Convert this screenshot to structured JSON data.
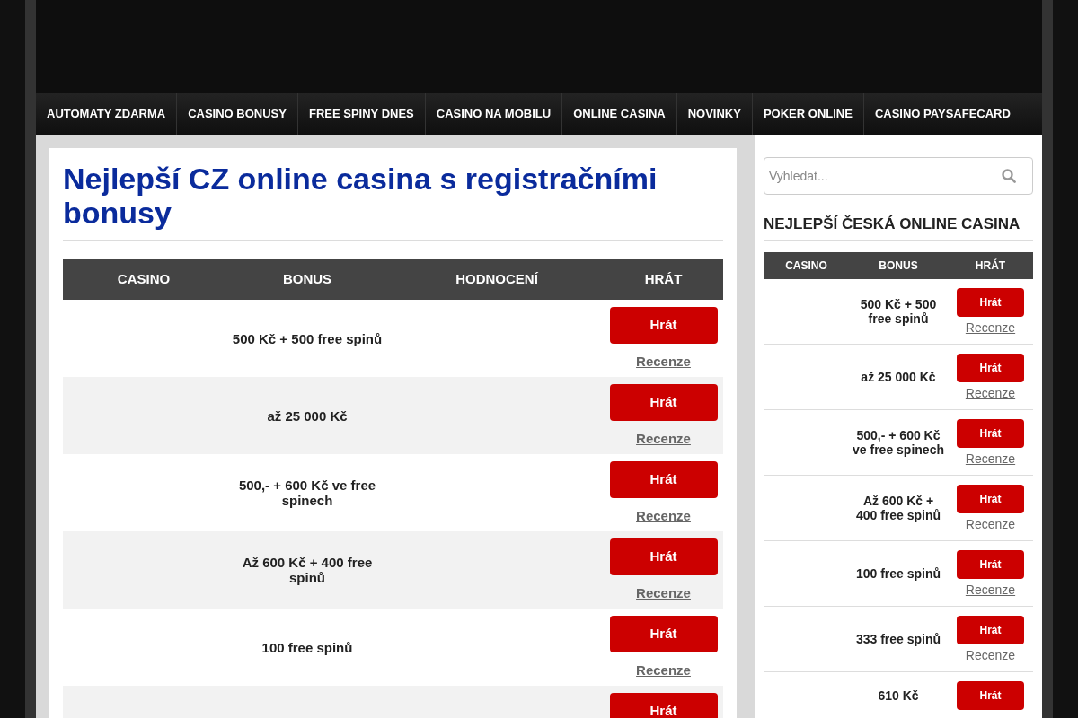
{
  "nav": {
    "items": [
      {
        "label": "AUTOMATY ZDARMA"
      },
      {
        "label": "CASINO BONUSY"
      },
      {
        "label": "FREE SPINY DNES"
      },
      {
        "label": "CASINO NA MOBILU"
      },
      {
        "label": "ONLINE CASINA"
      },
      {
        "label": "NOVINKY"
      },
      {
        "label": "POKER ONLINE"
      },
      {
        "label": "CASINO PAYSAFECARD"
      }
    ]
  },
  "main": {
    "title": "Nejlepší CZ online casina s registračními bonusy",
    "table": {
      "columns": [
        "CASINO",
        "BONUS",
        "HODNOCENÍ",
        "HRÁT"
      ],
      "rows": [
        {
          "bonus": "500 Kč + 500 free spinů",
          "play": "Hrát",
          "review": "Recenze"
        },
        {
          "bonus": "až 25 000 Kč",
          "play": "Hrát",
          "review": "Recenze"
        },
        {
          "bonus": "500,- + 600 Kč ve free spinech",
          "play": "Hrát",
          "review": "Recenze"
        },
        {
          "bonus": "Až 600 Kč + 400 free spinů",
          "play": "Hrát",
          "review": "Recenze"
        },
        {
          "bonus": "100 free spinů",
          "play": "Hrát",
          "review": "Recenze"
        },
        {
          "play": "Hrát"
        }
      ]
    }
  },
  "sidebar": {
    "search": {
      "placeholder": "Vyhledat..."
    },
    "heading": "NEJLEPŠÍ ČESKÁ ONLINE CASINA",
    "table": {
      "columns": [
        "CASINO",
        "BONUS",
        "HRÁT"
      ],
      "rows": [
        {
          "bonus": "500 Kč + 500 free spinů",
          "play": "Hrát",
          "review": "Recenze"
        },
        {
          "bonus": "až 25 000 Kč",
          "play": "Hrát",
          "review": "Recenze"
        },
        {
          "bonus": "500,- + 600 Kč ve free spinech",
          "play": "Hrát",
          "review": "Recenze"
        },
        {
          "bonus": "Až 600 Kč + 400 free spinů",
          "play": "Hrát",
          "review": "Recenze"
        },
        {
          "bonus": "100 free spinů",
          "play": "Hrát",
          "review": "Recenze"
        },
        {
          "bonus": "333 free spinů",
          "play": "Hrát",
          "review": "Recenze"
        },
        {
          "bonus": "610 Kč",
          "play": "Hrát"
        }
      ]
    }
  }
}
